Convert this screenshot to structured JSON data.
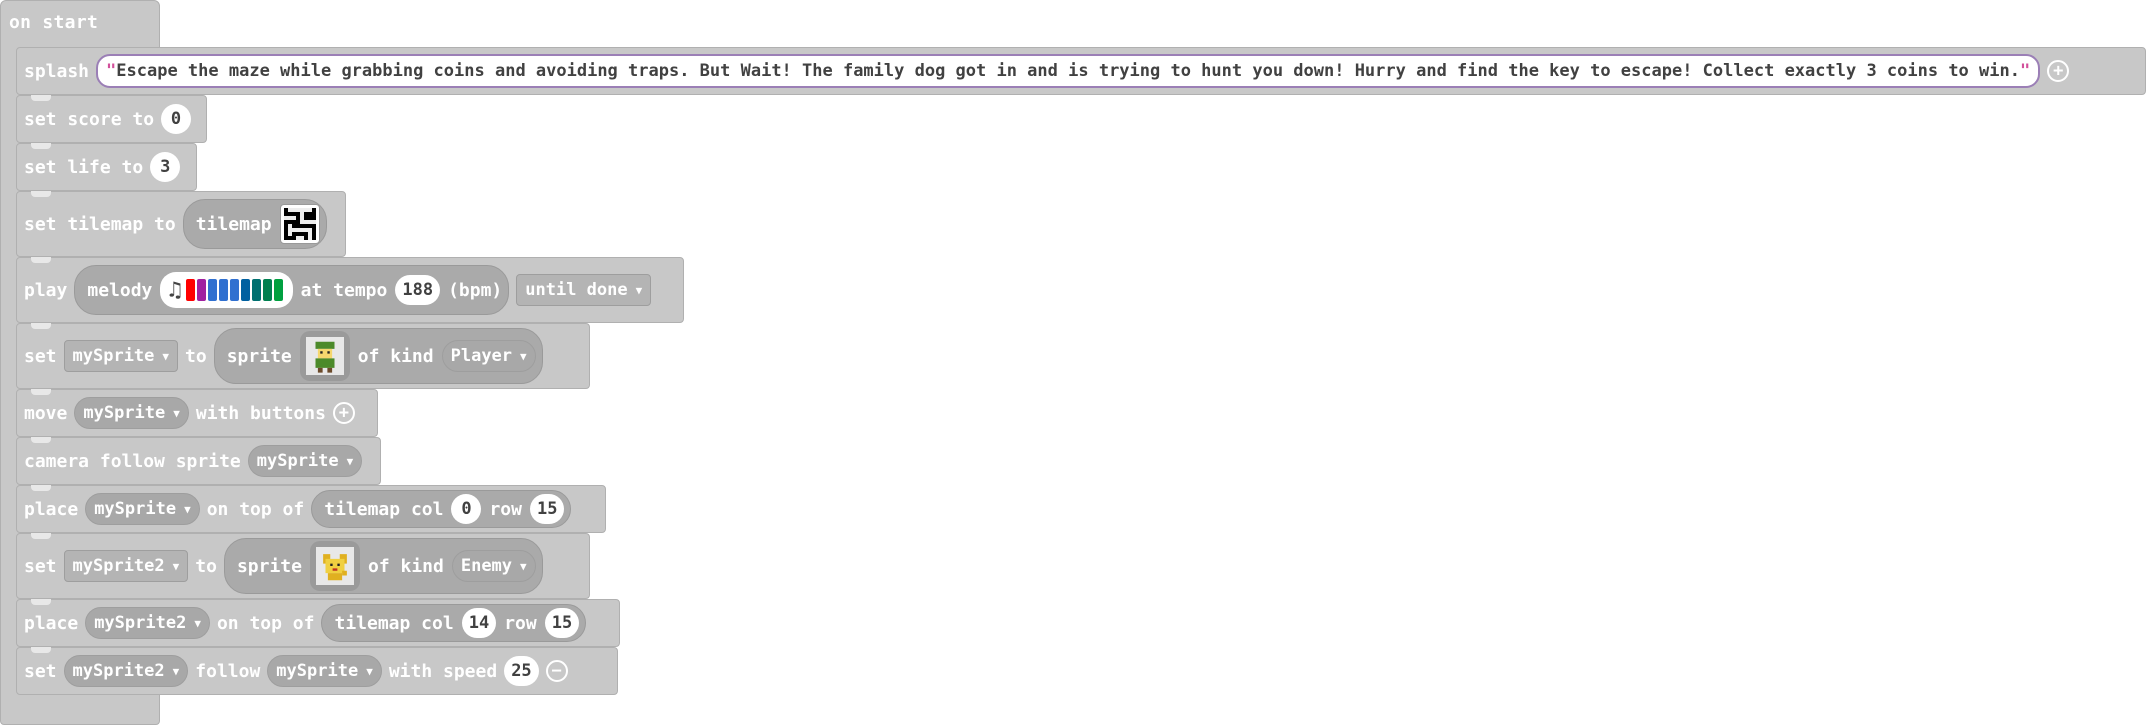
{
  "event": {
    "label": "on start"
  },
  "blocks": {
    "splash": {
      "keyword": "splash",
      "text": "Escape the maze while grabbing coins and avoiding traps. But Wait! The family dog got in and is trying to hunt you down! Hurry and find the key to escape! Collect exactly 3 coins to win.",
      "open_quote": "\"",
      "close_quote": "\""
    },
    "set_score": {
      "keyword": "set score to",
      "value": "0"
    },
    "set_life": {
      "keyword": "set life to",
      "value": "3"
    },
    "set_tilemap": {
      "keyword": "set tilemap to",
      "reporter": "tilemap"
    },
    "play": {
      "keyword": "play",
      "melody_label": "melody",
      "tempo_label": "at tempo",
      "tempo": "188",
      "unit": "(bpm)",
      "mode": "until done",
      "melody_colors": [
        "#ff0000",
        "#a020a0",
        "#3070d0",
        "#3070d0",
        "#3070d0",
        "#0060a0",
        "#007070",
        "#008050",
        "#00a040"
      ]
    },
    "set_sprite1": {
      "keyword_set": "set",
      "var": "mySprite",
      "keyword_to": "to",
      "sprite_label": "sprite",
      "kind_label": "of kind",
      "kind": "Player"
    },
    "move": {
      "keyword": "move",
      "var": "mySprite",
      "suffix": "with buttons"
    },
    "camera": {
      "keyword": "camera follow sprite",
      "var": "mySprite"
    },
    "place1": {
      "keyword": "place",
      "var": "mySprite",
      "on_top": "on top of",
      "tile_label": "tilemap col",
      "col": "0",
      "row_label": "row",
      "row": "15"
    },
    "set_sprite2": {
      "keyword_set": "set",
      "var": "mySprite2",
      "keyword_to": "to",
      "sprite_label": "sprite",
      "kind_label": "of kind",
      "kind": "Enemy"
    },
    "place2": {
      "keyword": "place",
      "var": "mySprite2",
      "on_top": "on top of",
      "tile_label": "tilemap col",
      "col": "14",
      "row_label": "row",
      "row": "15"
    },
    "follow": {
      "keyword_set": "set",
      "var": "mySprite2",
      "follow_label": "follow",
      "target": "mySprite",
      "speed_label": "with speed",
      "speed": "25"
    }
  },
  "icons": {
    "add": "plus-circle-icon",
    "remove": "minus-circle-icon",
    "music": "music-note-icon",
    "dropdown": "chevron-down-icon"
  }
}
